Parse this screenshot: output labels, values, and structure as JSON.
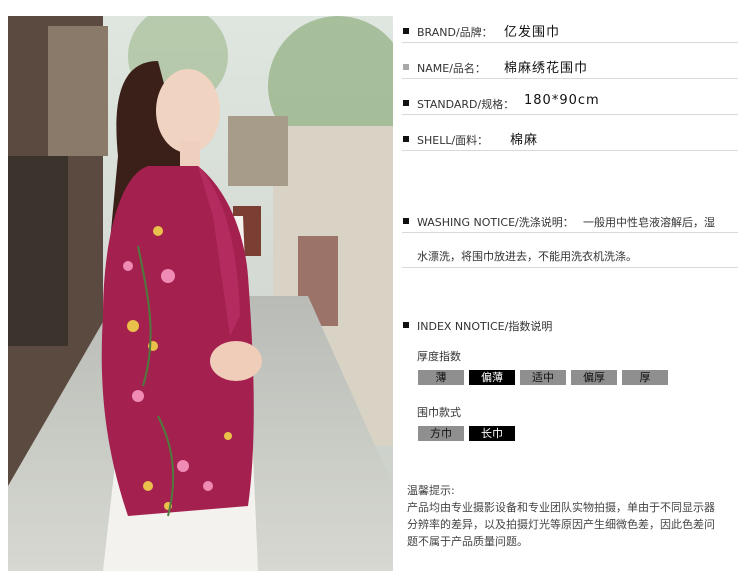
{
  "product_info": {
    "brand": {
      "label": "BRAND/品牌：",
      "value": "亿发围巾"
    },
    "name": {
      "label": "NAME/品名：",
      "value": "棉麻绣花围巾"
    },
    "standard": {
      "label": "STANDARD/规格：",
      "value": "180*90cm"
    },
    "shell": {
      "label": "SHELL/面料：",
      "value": "棉麻"
    },
    "washing": {
      "label": "WASHING NOTICE/洗涤说明：",
      "line1": "一般用中性皂液溶解后，湿",
      "line2": "水漂洗，将围巾放进去，不能用洗衣机洗涤。"
    },
    "index": {
      "label": "INDEX NNOTICE/指数说明"
    }
  },
  "thickness": {
    "title": "厚度指数",
    "options": [
      "薄",
      "偏薄",
      "适中",
      "偏厚",
      "厚"
    ],
    "selected": "偏薄"
  },
  "style": {
    "title": "围巾款式",
    "options": [
      "方巾",
      "长巾"
    ],
    "selected": "长巾"
  },
  "tips": {
    "title": "温馨提示:",
    "lines": [
      "产品均由专业摄影设备和专业团队实物拍摄，单由于不同显示器",
      "分辨率的差异，以及拍摄灯光等原因产生细微色差，因此色差问",
      "题不属于产品质量问题。"
    ]
  },
  "colors": {
    "scarf": "#a4204f",
    "selected_chip": "#000000",
    "chip": "#8f8f8f"
  }
}
